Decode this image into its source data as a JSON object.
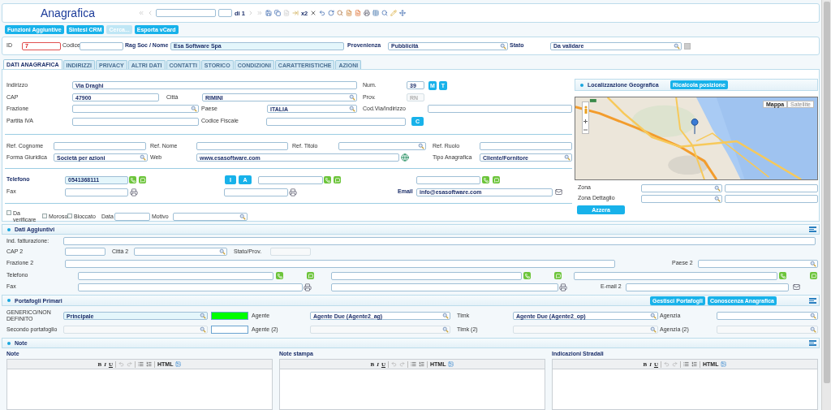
{
  "header": {
    "title": "Anagrafica",
    "record_count": "di 1",
    "copy_label": "x2"
  },
  "actions": [
    {
      "label": "Funzioni Aggiuntive",
      "disabled": false
    },
    {
      "label": "Sintesi CRM",
      "disabled": false
    },
    {
      "label": "Cerca...",
      "disabled": true
    },
    {
      "label": "Esporta vCard",
      "disabled": false
    }
  ],
  "id_bar": [
    {
      "kind": "label",
      "text": "ID"
    },
    {
      "kind": "field",
      "value": "7",
      "error": true
    },
    {
      "kind": "label",
      "text": "Codice"
    },
    {
      "kind": "field"
    },
    {
      "kind": "label",
      "text": "Rag Soc / Nome",
      "bold": true
    },
    {
      "kind": "field",
      "value": "Esa Software Spa",
      "highlighted": true
    },
    {
      "kind": "label",
      "text": "Provenienza",
      "bold": true
    },
    {
      "kind": "field",
      "value": "Pubblicità",
      "lookup": true
    },
    {
      "kind": "label",
      "text": "Stato",
      "bold": true
    },
    {
      "kind": "field",
      "value": "Da validare",
      "lookup": true
    }
  ],
  "tabs": [
    {
      "label": "DATI ANAGRAFICA",
      "selected": true
    },
    {
      "label": "INDIRIZZI",
      "selected": false
    },
    {
      "label": "PRIVACY",
      "selected": false
    },
    {
      "label": "ALTRI DATI",
      "selected": false
    },
    {
      "label": "CONTATTI",
      "selected": false
    },
    {
      "label": "STORICO",
      "selected": false
    },
    {
      "label": "CONDIZIONI",
      "selected": false
    },
    {
      "label": "CARATTERISTICHE",
      "selected": false
    },
    {
      "label": "AZIONI",
      "selected": false
    }
  ],
  "anagrafica": [
    [
      [
        {
          "kind": "label",
          "text": "Indirizzo"
        },
        {
          "kind": "field",
          "value": "Via Draghi"
        },
        {
          "kind": "label",
          "text": "Num."
        },
        {
          "kind": "field",
          "value": "39"
        },
        {
          "kind": "button",
          "label": "M"
        },
        {
          "kind": "button",
          "label": "T"
        }
      ],
      [
        {
          "kind": "label",
          "text": "CAP"
        },
        {
          "kind": "field",
          "value": "47900"
        },
        {
          "kind": "label",
          "text": "Città"
        },
        {
          "kind": "field",
          "value": "RIMINI",
          "lookup": true
        },
        {
          "kind": "label",
          "text": "Prov."
        },
        {
          "kind": "field",
          "value": "RN",
          "disabled": true
        }
      ],
      [
        {
          "kind": "label",
          "text": "Frazione"
        },
        {
          "kind": "field",
          "lookup": true
        },
        {
          "kind": "label",
          "text": "Paese"
        },
        {
          "kind": "field",
          "value": "ITALIA",
          "lookup": true
        },
        {
          "kind": "label",
          "text": "Cod.Via/Indirizzo"
        },
        {
          "kind": "field"
        }
      ],
      [
        {
          "kind": "label",
          "text": "Partita IVA"
        },
        {
          "kind": "field"
        },
        {
          "kind": "label",
          "text": "Codice Fiscale"
        },
        {
          "kind": "field"
        },
        {
          "kind": "button",
          "label": "C"
        }
      ]
    ],
    [
      [
        {
          "kind": "label",
          "text": "Ref. Cognome"
        },
        {
          "kind": "field"
        },
        {
          "kind": "label",
          "text": "Ref. Nome"
        },
        {
          "kind": "field"
        },
        {
          "kind": "label",
          "text": "Ref. Titolo"
        },
        {
          "kind": "field",
          "lookup": true
        },
        {
          "kind": "label",
          "text": "Ref. Ruolo"
        },
        {
          "kind": "field"
        }
      ],
      [
        {
          "kind": "label",
          "text": "Forma Giuridica"
        },
        {
          "kind": "field",
          "value": "Società per azioni",
          "lookup": true
        },
        {
          "kind": "label",
          "text": "Web"
        },
        {
          "kind": "field",
          "value": "www.esasoftware.com"
        },
        {
          "kind": "web"
        },
        {
          "kind": "label",
          "text": "Tipo Anagrafica"
        },
        {
          "kind": "field",
          "value": "Cliente/Fornitore",
          "lookup": true
        }
      ]
    ],
    [
      [
        {
          "kind": "label",
          "text": "Telefono",
          "bold": true
        },
        {
          "kind": "field",
          "value": "0541368111",
          "highlighted": true
        },
        {
          "kind": "phone"
        },
        {
          "kind": "button",
          "label": "I"
        },
        {
          "kind": "button",
          "label": "A"
        },
        {
          "kind": "field"
        },
        {
          "kind": "phone"
        },
        {
          "kind": "field"
        },
        {
          "kind": "phone"
        }
      ],
      [
        {
          "kind": "label",
          "text": "Fax"
        },
        {
          "kind": "field"
        },
        {
          "kind": "fax"
        },
        {
          "kind": "field"
        },
        {
          "kind": "fax"
        },
        {
          "kind": "label",
          "text": "Email",
          "bold": true
        },
        {
          "kind": "field",
          "value": "info@esasoftware.com"
        },
        {
          "kind": "mail"
        }
      ]
    ],
    [
      [
        {
          "kind": "checkbox",
          "label": "Da verificare",
          "checked": false
        },
        {
          "kind": "checkbox",
          "label": "Moroso",
          "checked": false
        },
        {
          "kind": "checkbox",
          "label": "Bloccato",
          "checked": false
        },
        {
          "kind": "label",
          "text": "Data"
        },
        {
          "kind": "field"
        },
        {
          "kind": "label",
          "text": "Motivo"
        },
        {
          "kind": "field",
          "lookup": true
        }
      ]
    ]
  ],
  "map_panel": {
    "title": "Localizzazione Geografica",
    "button": "Ricalcola posizione",
    "map_types": [
      {
        "label": "Mappa",
        "selected": true
      },
      {
        "label": "Satellite",
        "selected": false
      }
    ],
    "rows": [
      [
        {
          "kind": "label",
          "text": "Zona"
        },
        {
          "kind": "field",
          "lookup": true
        },
        {
          "kind": "field"
        }
      ],
      [
        {
          "kind": "label",
          "text": "Zona Dettaglio"
        },
        {
          "kind": "field",
          "lookup": true
        },
        {
          "kind": "field"
        }
      ]
    ],
    "reset_button": "Azzera"
  },
  "dati_aggiuntivi": {
    "title": "Dati Aggiuntivi",
    "rows": [
      [
        {
          "kind": "label",
          "text": "Ind. fatturazione:"
        },
        {
          "kind": "field"
        }
      ],
      [
        {
          "kind": "label",
          "text": "CAP 2"
        },
        {
          "kind": "field"
        },
        {
          "kind": "label",
          "text": "Città 2"
        },
        {
          "kind": "field",
          "lookup": true
        },
        {
          "kind": "label",
          "text": "Stato/Prov."
        },
        {
          "kind": "field",
          "disabled": true
        }
      ],
      [
        {
          "kind": "label",
          "text": "Frazione 2"
        },
        {
          "kind": "field"
        },
        {
          "kind": "label",
          "text": "Paese 2"
        },
        {
          "kind": "field",
          "lookup": true
        }
      ],
      [
        {
          "kind": "label",
          "text": "Telefono"
        },
        {
          "kind": "field"
        },
        {
          "kind": "phone"
        },
        {
          "kind": "field"
        },
        {
          "kind": "phone"
        },
        {
          "kind": "field"
        },
        {
          "kind": "phone"
        }
      ],
      [
        {
          "kind": "label",
          "text": "Fax"
        },
        {
          "kind": "field"
        },
        {
          "kind": "fax"
        },
        {
          "kind": "field"
        },
        {
          "kind": "fax"
        },
        {
          "kind": "label",
          "text": "E-mail 2"
        },
        {
          "kind": "field"
        },
        {
          "kind": "mail"
        }
      ]
    ]
  },
  "portafogli": {
    "title": "Portafogli Primari",
    "buttons": [
      "Gestisci Portafogli",
      "Conoscenza Anagrafica"
    ],
    "rows": [
      [
        {
          "kind": "label",
          "text": "GENERICO/NON DEFINITO"
        },
        {
          "kind": "field",
          "value": "Principale",
          "lookup": true,
          "highlighted": true
        },
        {
          "kind": "swatch",
          "color": "#00ff00"
        },
        {
          "kind": "label",
          "text": "Agente"
        },
        {
          "kind": "field",
          "value": "Agente Due (Agente2_ag)",
          "lookup": true
        },
        {
          "kind": "label",
          "text": "Tlmk"
        },
        {
          "kind": "field",
          "value": "Agente Due (Agente2_op)",
          "lookup": true
        },
        {
          "kind": "label",
          "text": "Agenzia"
        },
        {
          "kind": "field",
          "lookup": true
        }
      ],
      [
        {
          "kind": "label",
          "text": "Secondo portafoglio"
        },
        {
          "kind": "field",
          "lookup": true,
          "disabled": true
        },
        {
          "kind": "swatch",
          "color": "#ffffff"
        },
        {
          "kind": "label",
          "text": "Agente (2)"
        },
        {
          "kind": "field",
          "lookup": true,
          "disabled": true
        },
        {
          "kind": "label",
          "text": "Tlmk (2)"
        },
        {
          "kind": "field",
          "lookup": true,
          "disabled": true
        },
        {
          "kind": "label",
          "text": "Agenzia (2)"
        },
        {
          "kind": "field",
          "lookup": true,
          "disabled": true
        }
      ]
    ]
  },
  "notes": {
    "title": "Note",
    "editors": [
      {
        "title": "Note",
        "tools": [
          "B",
          "I",
          "U",
          "HTML"
        ]
      },
      {
        "title": "Note stampa",
        "tools": [
          "B",
          "I",
          "U",
          "HTML"
        ]
      },
      {
        "title": "Indicazioni Stradali",
        "tools": [
          "B",
          "I",
          "U",
          "HTML"
        ]
      }
    ]
  }
}
